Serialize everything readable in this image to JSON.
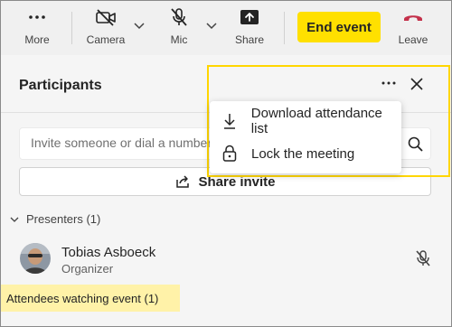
{
  "toolbar": {
    "more_label": "More",
    "camera_label": "Camera",
    "mic_label": "Mic",
    "share_label": "Share",
    "end_event_label": "End event",
    "leave_label": "Leave"
  },
  "participants": {
    "title": "Participants",
    "search_placeholder": "Invite someone or dial a number",
    "share_invite_label": "Share invite",
    "presenters_label": "Presenters (1)",
    "presenter": {
      "name": "Tobias Asboeck",
      "role": "Organizer"
    },
    "attendees_label": "Attendees watching event (1)"
  },
  "menu": {
    "items": [
      {
        "label": "Download attendance list",
        "icon": "download-icon"
      },
      {
        "label": "Lock the meeting",
        "icon": "lock-icon"
      }
    ]
  },
  "colors": {
    "end_event_bg": "#ffe000",
    "leave_red": "#c4314b",
    "highlight_border": "#ffd600",
    "attendees_highlight": "#fff2a8",
    "toolbar_bg": "#f0f0f0",
    "panel_bg": "#f5f5f5"
  }
}
